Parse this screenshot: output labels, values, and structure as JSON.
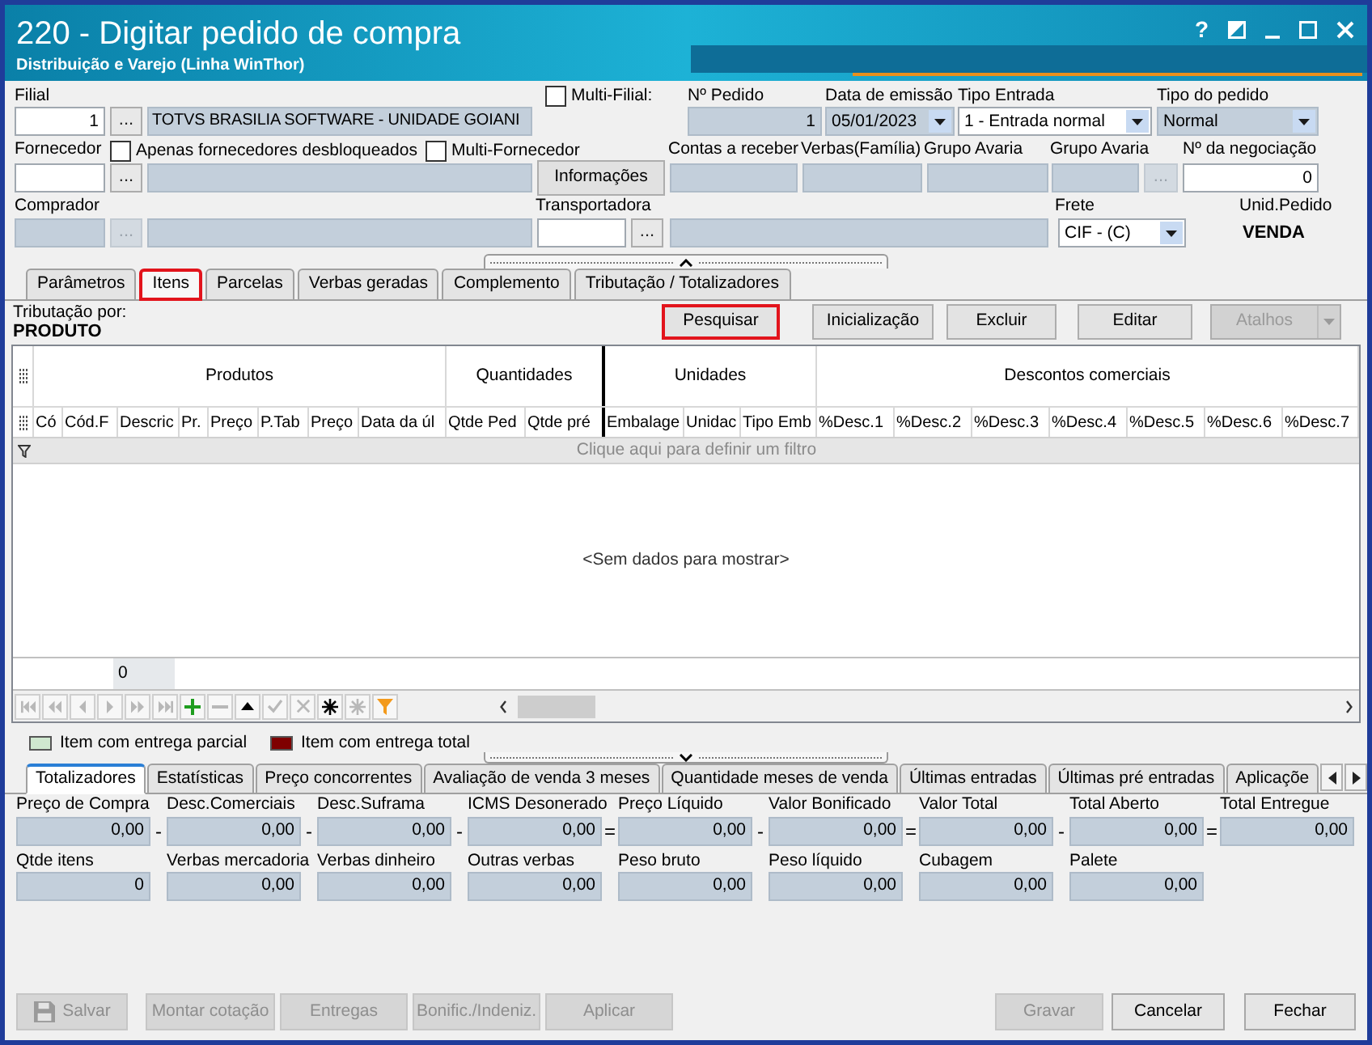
{
  "window": {
    "title": "220 - Digitar pedido de compra",
    "subtitle": "Distribuição e Varejo (Linha WinThor)",
    "help": "?"
  },
  "header": {
    "filial": {
      "label": "Filial",
      "value": "1",
      "disabled": false,
      "lookup": {
        "text": "...",
        "disabled": false
      },
      "name": {
        "value": "TOTVS BRASILIA SOFTWARE - UNIDADE GOIANI",
        "disabled": true
      }
    },
    "multi_filial": {
      "label": "Multi-Filial:",
      "checked": false
    },
    "numero_pedido": {
      "label": "Nº Pedido",
      "value": "1",
      "disabled": true
    },
    "data_emissao": {
      "label": "Data de emissão",
      "value": "05/01/2023",
      "disabled": true
    },
    "tipo_entrada": {
      "label": "Tipo Entrada",
      "value": "1 - Entrada normal",
      "disabled": false
    },
    "tipo_pedido": {
      "label": "Tipo do pedido",
      "value": "Normal",
      "disabled": true
    },
    "fornecedor": {
      "label": "Fornecedor",
      "disabled": false,
      "lookup": {
        "text": "...",
        "disabled": false
      },
      "name": {
        "disabled": true
      }
    },
    "apenas_desbloqueados": {
      "label": "Apenas fornecedores desbloqueados",
      "checked": false
    },
    "multi_fornecedor": {
      "label": "Multi-Fornecedor",
      "checked": false
    },
    "informacoes": {
      "label": "Informações"
    },
    "contas_receber": {
      "label": "Contas a receber",
      "disabled": true
    },
    "verbas_familia": {
      "label": "Verbas(Família)",
      "disabled": true
    },
    "grupo_avaria": {
      "label": "Grupo Avaria",
      "disabled": true
    },
    "grupo_avaria_2": {
      "label": "Grupo Avaria",
      "disabled": true,
      "lookup": {
        "text": "...",
        "disabled": true
      }
    },
    "negociacao": {
      "label": "Nº da negociação",
      "value": "0",
      "disabled": false
    },
    "comprador": {
      "label": "Comprador",
      "disabled": true,
      "lookup": {
        "text": "...",
        "disabled": true
      },
      "name": {
        "disabled": true
      }
    },
    "transportadora": {
      "label": "Transportadora",
      "disabled": false,
      "lookup": {
        "text": "...",
        "disabled": false
      },
      "name": {
        "disabled": true
      }
    },
    "frete": {
      "label": "Frete",
      "value": "CIF - (C)",
      "disabled": false
    },
    "unid_pedido": {
      "label": "Unid.Pedido",
      "value": "VENDA"
    }
  },
  "tabs": [
    {
      "label": "Parâmetros",
      "selected": false,
      "highlighted": false
    },
    {
      "label": "Itens",
      "selected": true,
      "highlighted": true
    },
    {
      "label": "Parcelas",
      "selected": false,
      "highlighted": false
    },
    {
      "label": "Verbas geradas",
      "selected": false,
      "highlighted": false
    },
    {
      "label": "Complemento",
      "selected": false,
      "highlighted": false
    },
    {
      "label": "Tributação / Totalizadores",
      "selected": false,
      "highlighted": false
    }
  ],
  "items": {
    "tributacao": {
      "label": "Tributação por:",
      "value": "PRODUTO"
    },
    "buttons": [
      {
        "label": "Pesquisar",
        "kind": "plain",
        "highlighted": true,
        "disabled": false
      },
      {
        "label": "Inicialização",
        "kind": "plain",
        "highlighted": false,
        "disabled": false
      },
      {
        "label": "Excluir",
        "kind": "plain",
        "highlighted": false,
        "disabled": false
      },
      {
        "label": "Editar",
        "kind": "plain",
        "highlighted": false,
        "disabled": false
      },
      {
        "label": "Atalhos",
        "kind": "split",
        "highlighted": false,
        "disabled": true
      }
    ],
    "grid": {
      "groups": [
        {
          "label": "Produtos",
          "columns": [
            "Có",
            "Cód.F",
            "Descric",
            "Pr.",
            "Preço",
            "P.Tab",
            "Preço",
            "Data da úl"
          ]
        },
        {
          "label": "Quantidades",
          "columns": [
            "Qtde Ped",
            "Qtde pré"
          ]
        },
        {
          "label": "Unidades",
          "columns": [
            "Embalage",
            "Unidac",
            "Tipo Emb"
          ]
        },
        {
          "label": "Descontos comerciais",
          "columns": [
            "%Desc.1",
            "%Desc.2",
            "%Desc.3",
            "%Desc.4",
            "%Desc.5",
            "%Desc.6",
            "%Desc.7"
          ]
        }
      ],
      "filter_hint": "Clique aqui para definir um filtro",
      "empty_text": "<Sem dados para mostrar>",
      "footer_value": "0"
    },
    "navigator": [
      {
        "kind": "first",
        "disabled": true
      },
      {
        "kind": "prev_page",
        "disabled": true
      },
      {
        "kind": "prev",
        "disabled": true
      },
      {
        "kind": "next",
        "disabled": true
      },
      {
        "kind": "next_page",
        "disabled": true
      },
      {
        "kind": "last",
        "disabled": true
      },
      {
        "kind": "insert",
        "disabled": false
      },
      {
        "kind": "delete",
        "disabled": true
      },
      {
        "kind": "edit",
        "disabled": false
      },
      {
        "kind": "post",
        "disabled": true
      },
      {
        "kind": "cancel",
        "disabled": true
      },
      {
        "kind": "save_bookmark",
        "disabled": false
      },
      {
        "kind": "goto_bookmark",
        "disabled": true
      },
      {
        "kind": "filter",
        "disabled": false
      }
    ],
    "legend": [
      {
        "label": "Item com entrega parcial",
        "color": "#cfe8cf"
      },
      {
        "label": "Item com entrega total",
        "color": "#7f0000"
      }
    ]
  },
  "bottom_tabs": [
    {
      "label": "Totalizadores",
      "selected": true
    },
    {
      "label": "Estatísticas",
      "selected": false
    },
    {
      "label": "Preço concorrentes",
      "selected": false
    },
    {
      "label": "Avaliação de venda 3 meses",
      "selected": false
    },
    {
      "label": "Quantidade meses de venda",
      "selected": false
    },
    {
      "label": "Últimas entradas",
      "selected": false
    },
    {
      "label": "Últimas pré entradas",
      "selected": false
    },
    {
      "label": "Aplicaçõe",
      "selected": false
    }
  ],
  "totals": {
    "row_1": [
      {
        "label": "Preço de Compra",
        "value": "0,00",
        "operator": "-"
      },
      {
        "label": "Desc.Comerciais",
        "value": "0,00",
        "operator": "-"
      },
      {
        "label": "Desc.Suframa",
        "value": "0,00",
        "operator": "-"
      },
      {
        "label": "ICMS Desonerado",
        "value": "0,00",
        "operator": "="
      },
      {
        "label": "Preço Líquido",
        "value": "0,00",
        "operator": "-"
      },
      {
        "label": "Valor Bonificado",
        "value": "0,00",
        "operator": "="
      },
      {
        "label": "Valor Total",
        "value": "0,00",
        "operator": "-"
      },
      {
        "label": "Total Aberto",
        "value": "0,00",
        "operator": "="
      },
      {
        "label": "Total Entregue",
        "value": "0,00"
      }
    ],
    "row_2": [
      {
        "label": "Qtde itens",
        "value": "0"
      },
      {
        "label": "Verbas mercadoria",
        "value": "0,00"
      },
      {
        "label": "Verbas dinheiro",
        "value": "0,00"
      },
      {
        "label": "Outras verbas",
        "value": "0,00"
      },
      {
        "label": "Peso bruto",
        "value": "0,00"
      },
      {
        "label": "Peso líquido",
        "value": "0,00"
      },
      {
        "label": "Cubagem",
        "value": "0,00"
      },
      {
        "label": "Palete",
        "value": "0,00"
      }
    ]
  },
  "footer": {
    "left": [
      {
        "label": "Salvar",
        "kind": "save",
        "disabled": true
      },
      {
        "label": "Montar cotação",
        "kind": "text",
        "disabled": true
      },
      {
        "label": "Entregas",
        "kind": "text",
        "disabled": true
      },
      {
        "label": "Bonific./Indeniz.",
        "kind": "text",
        "disabled": true
      },
      {
        "label": "Aplicar",
        "kind": "text",
        "disabled": true
      }
    ],
    "right": [
      {
        "label": "Gravar",
        "kind": "text",
        "disabled": true
      },
      {
        "label": "Cancelar",
        "kind": "text",
        "disabled": false
      },
      {
        "label": "Fechar",
        "kind": "text",
        "disabled": false
      }
    ]
  }
}
